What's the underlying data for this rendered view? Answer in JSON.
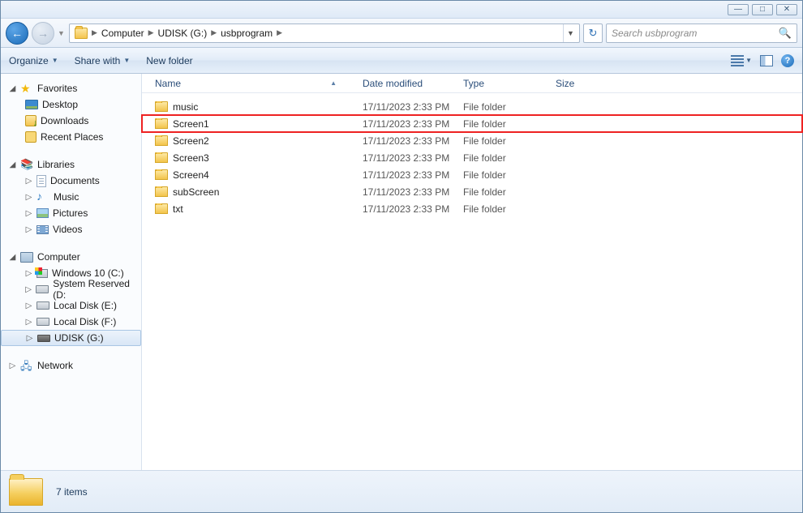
{
  "window": {
    "min_icon": "—",
    "max_icon": "□",
    "close_icon": "✕"
  },
  "nav": {
    "back_icon": "←",
    "fwd_icon": "→",
    "history_dd": "▼",
    "breadcrumb": {
      "seg1": "Computer",
      "seg2": "UDISK (G:)",
      "seg3": "usbprogram",
      "sep": "▶"
    },
    "addr_dd": "▼",
    "refresh_icon": "↻",
    "search_placeholder": "Search usbprogram",
    "search_icon": "🔍"
  },
  "toolbar": {
    "organize": "Organize",
    "share": "Share with",
    "newfolder": "New folder",
    "dd": "▼",
    "help": "?"
  },
  "sidebar": {
    "favorites": {
      "label": "Favorites",
      "items": [
        {
          "label": "Desktop"
        },
        {
          "label": "Downloads"
        },
        {
          "label": "Recent Places"
        }
      ]
    },
    "libraries": {
      "label": "Libraries",
      "items": [
        {
          "label": "Documents"
        },
        {
          "label": "Music"
        },
        {
          "label": "Pictures"
        },
        {
          "label": "Videos"
        }
      ]
    },
    "computer": {
      "label": "Computer",
      "items": [
        {
          "label": "Windows 10 (C:)"
        },
        {
          "label": "System Reserved (D:"
        },
        {
          "label": "Local Disk (E:)"
        },
        {
          "label": "Local Disk (F:)"
        },
        {
          "label": "UDISK (G:)"
        }
      ]
    },
    "network": {
      "label": "Network"
    }
  },
  "columns": {
    "name": "Name",
    "date": "Date modified",
    "type": "Type",
    "size": "Size",
    "sort": "▲"
  },
  "rows": [
    {
      "name": "music",
      "date": "17/11/2023 2:33 PM",
      "type": "File folder",
      "size": "",
      "hl": false
    },
    {
      "name": "Screen1",
      "date": "17/11/2023 2:33 PM",
      "type": "File folder",
      "size": "",
      "hl": true
    },
    {
      "name": "Screen2",
      "date": "17/11/2023 2:33 PM",
      "type": "File folder",
      "size": "",
      "hl": false
    },
    {
      "name": "Screen3",
      "date": "17/11/2023 2:33 PM",
      "type": "File folder",
      "size": "",
      "hl": false
    },
    {
      "name": "Screen4",
      "date": "17/11/2023 2:33 PM",
      "type": "File folder",
      "size": "",
      "hl": false
    },
    {
      "name": "subScreen",
      "date": "17/11/2023 2:33 PM",
      "type": "File folder",
      "size": "",
      "hl": false
    },
    {
      "name": "txt",
      "date": "17/11/2023 2:33 PM",
      "type": "File folder",
      "size": "",
      "hl": false
    }
  ],
  "status": {
    "text": "7 items"
  }
}
